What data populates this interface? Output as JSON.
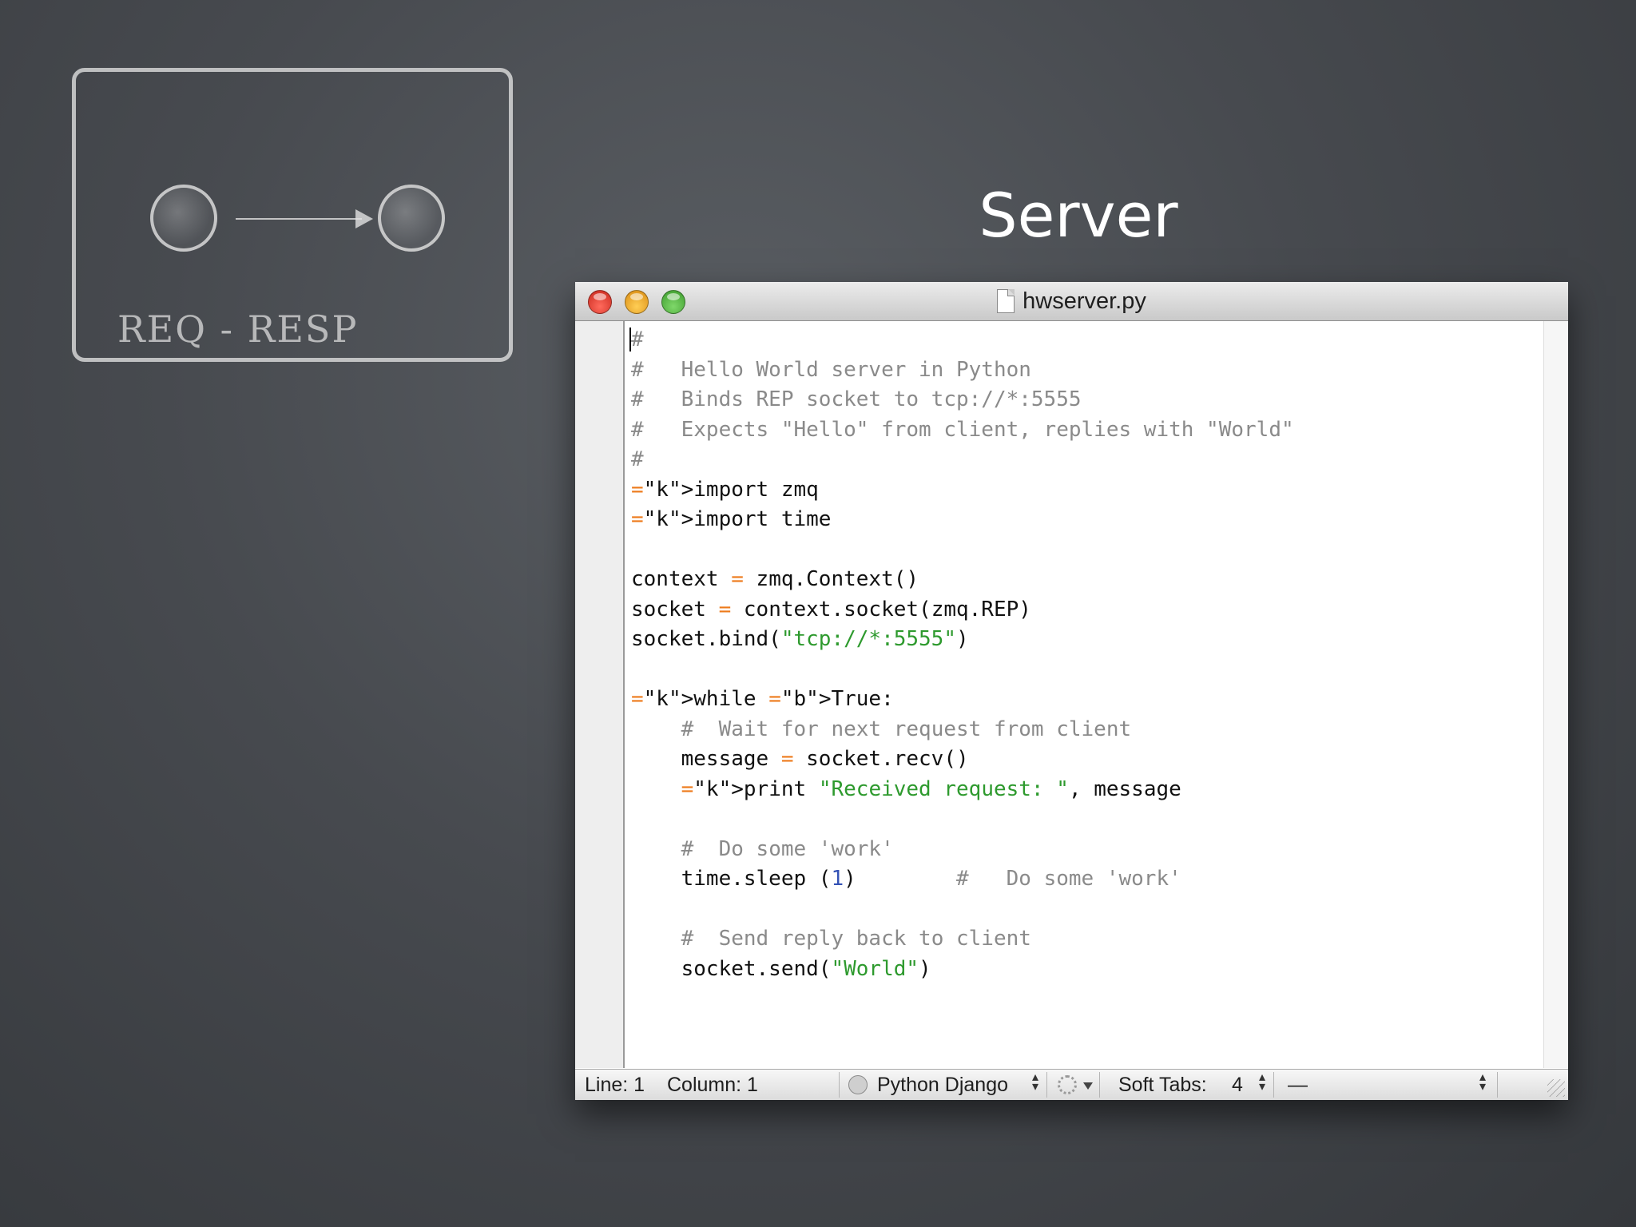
{
  "slide": {
    "title": "Server",
    "diagram_label": "REQ - RESP"
  },
  "window": {
    "title": "hwserver.py",
    "buttons": [
      "close",
      "minimize",
      "zoom"
    ]
  },
  "code": {
    "lines": [
      "#",
      "#   Hello World server in Python",
      "#   Binds REP socket to tcp://*:5555",
      "#   Expects \"Hello\" from client, replies with \"World\"",
      "#",
      "import zmq",
      "import time",
      "",
      "context = zmq.Context()",
      "socket = context.socket(zmq.REP)",
      "socket.bind(\"tcp://*:5555\")",
      "",
      "while True:",
      "    #  Wait for next request from client",
      "    message = socket.recv()",
      "    print \"Received request: \", message",
      "",
      "    #  Do some 'work'",
      "    time.sleep (1)        #   Do some 'work'",
      "",
      "    #  Send reply back to client",
      "    socket.send(\"World\")"
    ],
    "syntax_colors": {
      "keyword": "#ed7a1a",
      "builtin": "#3452b5",
      "string": "#2e9a2e",
      "comment": "#8a8a8a"
    }
  },
  "statusbar": {
    "line": "Line: 1",
    "column": "Column: 1",
    "language": "Python Django",
    "tabs_label": "Soft Tabs:",
    "tabs_value": "4",
    "symbol": "—"
  },
  "icons": [
    "clock-icon",
    "gear-icon",
    "document-icon",
    "resize-grip-icon"
  ]
}
